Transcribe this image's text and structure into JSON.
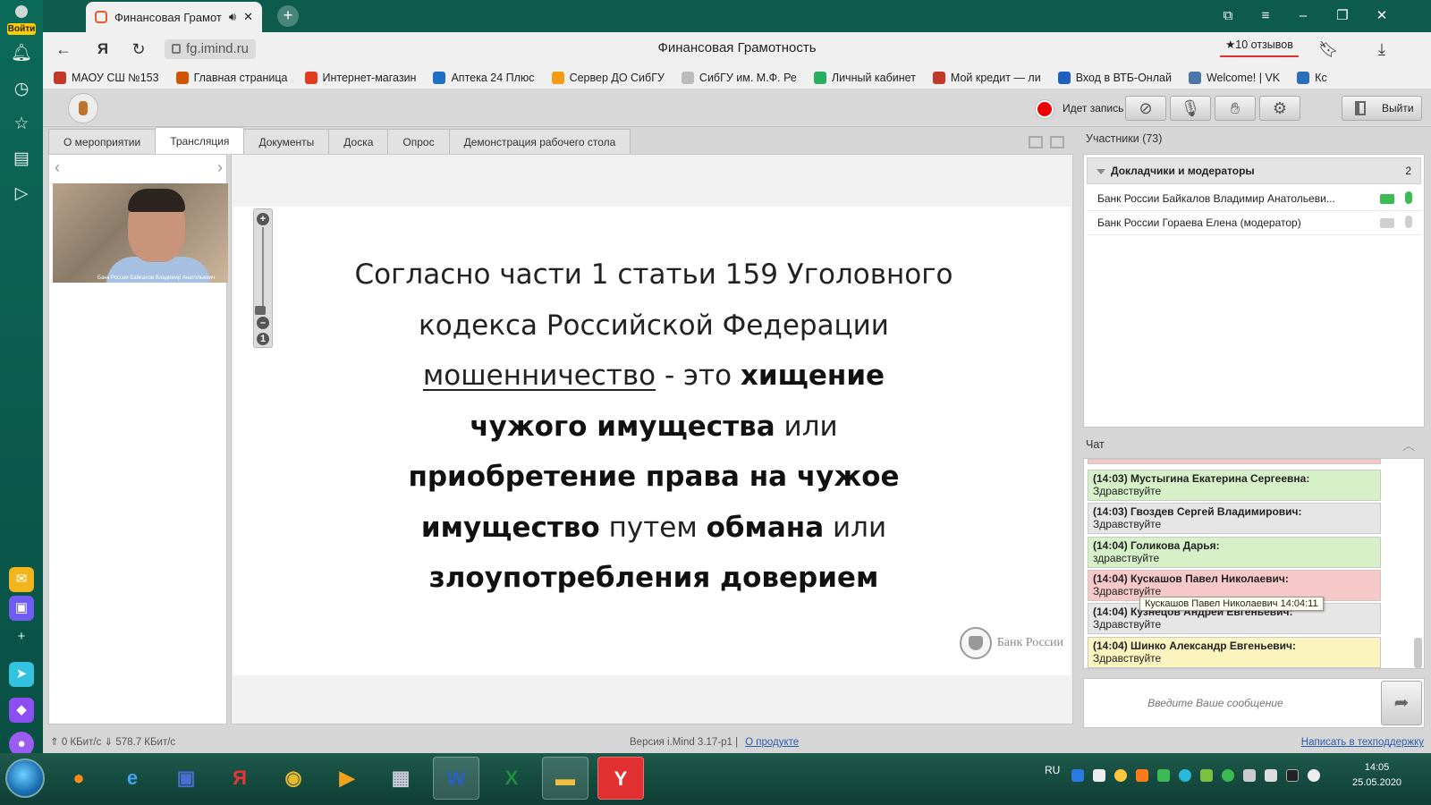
{
  "browser": {
    "sidebar": {
      "login_label": "Войти"
    },
    "tab": {
      "title": "Финансовая Грамот"
    },
    "address": {
      "url": "fg.imind.ru",
      "page_title": "Финансовая Грамотность",
      "reviews": "★10 отзывов"
    },
    "bookmarks": [
      {
        "label": "МАОУ СШ №153",
        "color": "#c0392b"
      },
      {
        "label": "Главная страница",
        "color": "#d35400"
      },
      {
        "label": "Интернет-магазин",
        "color": "#e03c1f"
      },
      {
        "label": "Аптека 24 Плюс",
        "color": "#1f6fc5"
      },
      {
        "label": "Сервер ДО СибГУ",
        "color": "#f39c12"
      },
      {
        "label": "СибГУ им. М.Ф. Ре",
        "color": "#bbbbbb"
      },
      {
        "label": "Личный кабинет",
        "color": "#27ae60"
      },
      {
        "label": "Мой кредит — ли",
        "color": "#c0392b"
      },
      {
        "label": "Вход в ВТБ-Онлай",
        "color": "#1f5fbf"
      },
      {
        "label": "Welcome! | VK",
        "color": "#4a76a8"
      },
      {
        "label": "Кс",
        "color": "#2c6fbb"
      }
    ]
  },
  "app": {
    "recording_label": "Идет запись",
    "exit_label": "Выйти",
    "tabs": [
      {
        "label": "О мероприятии"
      },
      {
        "label": "Трансляция"
      },
      {
        "label": "Документы"
      },
      {
        "label": "Доска"
      },
      {
        "label": "Опрос"
      },
      {
        "label": "Демонстрация рабочего стола"
      }
    ],
    "video_caption": "Банк России Байкалов Владимир Анатольевич",
    "slide": {
      "line1": "Согласно части 1 статьи 159 Уголовного",
      "line2": "кодекса Российской Федерации",
      "term": "мошенничество",
      "dash": " - это ",
      "b1": "хищение",
      "b2": "чужого имущества",
      "ili1": " или",
      "b3": "приобретение права на чужое",
      "b4": "имущество",
      "putem": " путем ",
      "b5": "обмана",
      "ili2": " или",
      "b6": "злоупотребления доверием",
      "logo_text": "Банк России"
    },
    "participants": {
      "header": "Участники (73)",
      "group_label": "Докладчики и модераторы",
      "group_count": "2",
      "rows": [
        {
          "name": "Банк России Байкалов Владимир Анатольеви...",
          "cam": "#3cba54",
          "mic": "#3cba54"
        },
        {
          "name": "Банк России Гораева Елена (модератор)",
          "cam": "#cfcfcf",
          "mic": "#cfcfcf"
        }
      ]
    },
    "chat": {
      "header": "Чат",
      "messages": [
        {
          "head": "(14:03) Мустыгина Екатерина Сергеевна:",
          "text": "Здравствуйте",
          "bg": "#d6f0c8"
        },
        {
          "head": "(14:03) Гвоздев Сергей Владимирович:",
          "text": "Здравствуйте",
          "bg": "#e6e6e6"
        },
        {
          "head": "(14:04) Голикова Дарья:",
          "text": "здравствуйте",
          "bg": "#d6f0c8"
        },
        {
          "head": "(14:04) Кускашов Павел Николаевич:",
          "text": "Здравствуйте",
          "bg": "#f7c8c8"
        },
        {
          "head": "(14:04) Кузнецов Андрей Евгеньевич:",
          "text": "Здравствуйте",
          "bg": "#e6e6e6"
        },
        {
          "head": "(14:04) Шинко Александр Евгеньевич:",
          "text": "Здравствуйте",
          "bg": "#fbf4bf"
        }
      ],
      "tooltip": "Кускашов Павел Николаевич 14:04:11",
      "input_placeholder": "Введите Ваше сообщение"
    },
    "status": {
      "speed": "⇑ 0 КБит/с   ⇓ 578.7 КБит/с",
      "version": "Версия i.Mind 3.17-p1  |",
      "about_link": "О продукте",
      "support_link": "Написать в техподдержку"
    }
  },
  "taskbar": {
    "lang": "RU",
    "time": "14:05",
    "date": "25.05.2020"
  }
}
